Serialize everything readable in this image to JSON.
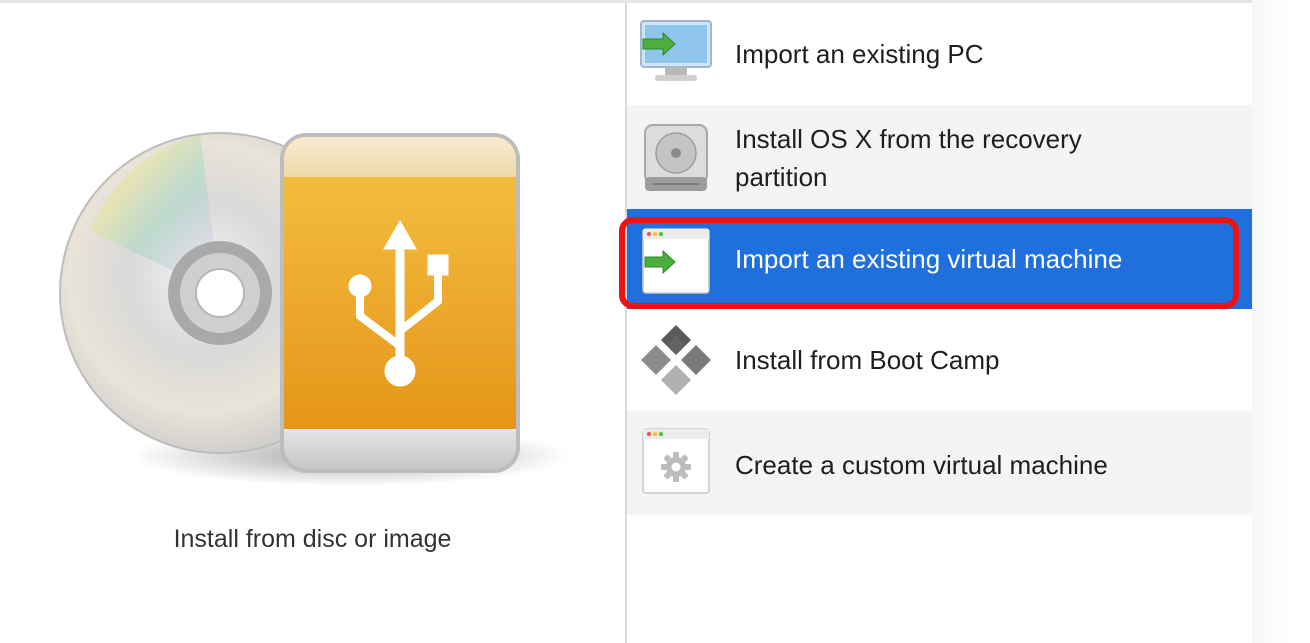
{
  "left": {
    "caption": "Install from disc or image"
  },
  "list": {
    "items": [
      {
        "label": "Import an existing PC"
      },
      {
        "label": "Install OS X from the recovery partition",
        "line1": "Install OS X from the recovery",
        "line2": "partition"
      },
      {
        "label": "Import an existing virtual machine",
        "selected": true
      },
      {
        "label": "Install from Boot Camp"
      },
      {
        "label": "Create a custom virtual machine"
      }
    ]
  },
  "colors": {
    "selection_blue": "#1f6fdc",
    "highlight_red": "#ee1111",
    "usb_orange": "#e9a227"
  }
}
